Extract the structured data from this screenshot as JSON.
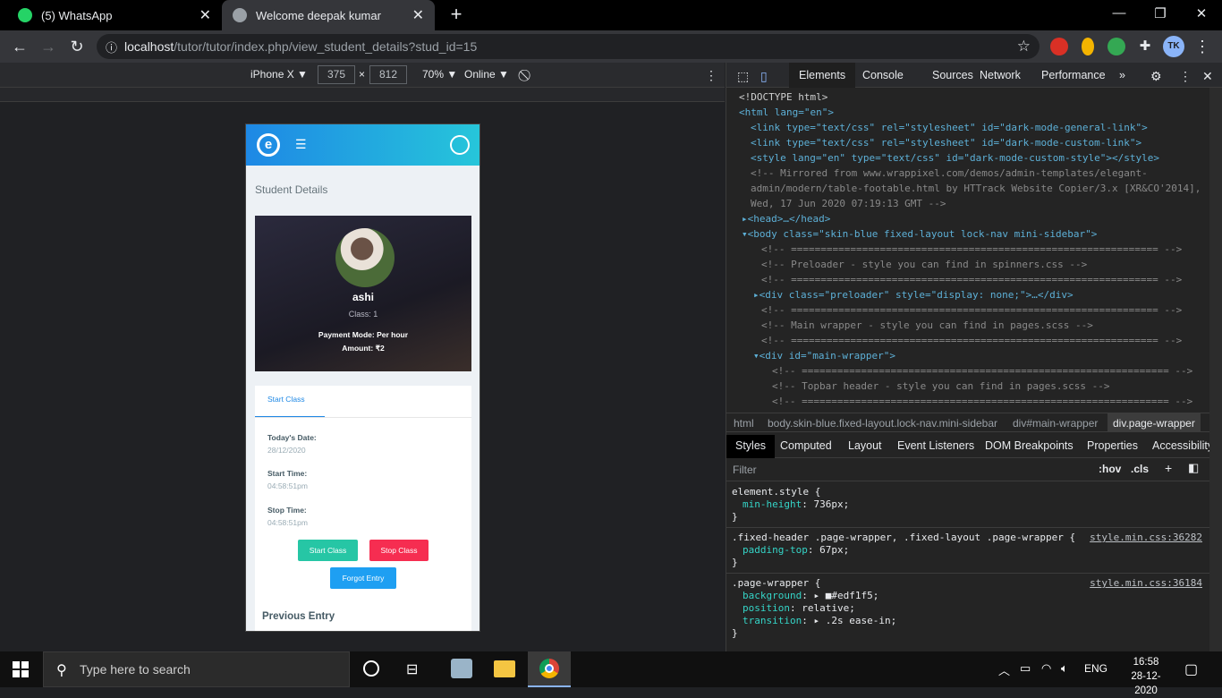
{
  "browser": {
    "tabs": [
      {
        "title": "(5) WhatsApp",
        "icon": "whatsapp-icon",
        "color": "#25d366"
      },
      {
        "title": "Welcome deepak kumar",
        "icon": "globe-icon",
        "color": "#9aa0a6"
      }
    ],
    "url_host": "localhost",
    "url_path": "/tutor/tutor/index.php/view_student_details?stud_id=15",
    "avatar_text": "TK"
  },
  "device_toolbar": {
    "device": "iPhone X ▼",
    "width": "375",
    "times": "×",
    "height": "812",
    "zoom": "70% ▼",
    "network": "Online ▼"
  },
  "app": {
    "logo_letter": "e",
    "page_title": "Student Details",
    "student": {
      "name": "ashi",
      "class": "Class: 1",
      "payment_mode": "Payment Mode: Per hour",
      "amount": "Amount: ₹2"
    },
    "tab_label": "Start Class",
    "fields": [
      {
        "label": "Today's Date:",
        "value": "28/12/2020"
      },
      {
        "label": "Start Time:",
        "value": "04:58:51pm"
      },
      {
        "label": "Stop Time:",
        "value": "04:58:51pm"
      }
    ],
    "buttons": {
      "start": "Start Class",
      "stop": "Stop Class",
      "forgot": "Forgot Entry"
    },
    "previous_heading": "Previous Entry",
    "colors": {
      "start": "#26c6a5",
      "stop": "#f62d51",
      "forgot": "#1e9ff2",
      "header_from": "#1e88e5",
      "header_to": "#26c6da"
    }
  },
  "devtools": {
    "tabs": [
      "Elements",
      "Console",
      "Sources",
      "Network",
      "Performance",
      "»"
    ],
    "code_lines": [
      "<!DOCTYPE html>",
      "<html lang=\"en\">",
      "<link type=\"text/css\" rel=\"stylesheet\" id=\"dark-mode-general-link\">",
      "<link type=\"text/css\" rel=\"stylesheet\" id=\"dark-mode-custom-link\">",
      "<style lang=\"en\" type=\"text/css\" id=\"dark-mode-custom-style\"></style>",
      "<!-- Mirrored from www.wrappixel.com/demos/admin-templates/elegant-",
      "admin/modern/table-footable.html by HTTrack Website Copier/3.x [XR&CO'2014],",
      "Wed, 17 Jun 2020 07:19:13 GMT -->",
      "▸<head>…</head>",
      "▾<body class=\"skin-blue fixed-layout lock-nav mini-sidebar\">",
      "<!-- ============================================================== -->",
      "<!-- Preloader - style you can find in spinners.css -->",
      "<!-- ============================================================== -->",
      "▸<div class=\"preloader\" style=\"display: none;\">…</div>",
      "<!-- ============================================================== -->",
      "<!-- Main wrapper - style you can find in pages.scss -->",
      "<!-- ============================================================== -->",
      "▾<div id=\"main-wrapper\">",
      "<!-- ============================================================== -->",
      "<!-- Topbar header - style you can find in pages.scss -->",
      "<!-- ============================================================== -->"
    ],
    "breadcrumbs": [
      "html",
      "body.skin-blue.fixed-layout.lock-nav.mini-sidebar",
      "div#main-wrapper",
      "div.page-wrapper"
    ],
    "style_tabs": [
      "Styles",
      "Computed",
      "Layout",
      "Event Listeners",
      "DOM Breakpoints",
      "Properties",
      "Accessibility"
    ],
    "filter_placeholder": "Filter",
    "filter_hov": ":hov",
    "filter_cls": ".cls",
    "rules": [
      {
        "selector": "element.style {",
        "props": [
          [
            "min-height",
            "736px;"
          ]
        ],
        "source": ""
      },
      {
        "selector": ".fixed-header .page-wrapper, .fixed-layout .page-wrapper {",
        "props": [
          [
            "padding-top",
            "67px;"
          ]
        ],
        "source": "style.min.css:36282"
      },
      {
        "selector": ".page-wrapper {",
        "props": [
          [
            "background",
            "▸ ■#edf1f5;"
          ],
          [
            "position",
            "relative;"
          ],
          [
            "transition",
            "▸ .2s ease-in;"
          ]
        ],
        "source": "style.min.css:36184"
      }
    ]
  },
  "taskbar": {
    "search_placeholder": "Type here to search",
    "lang": "ENG",
    "time": "16:58",
    "date": "28-12-2020"
  }
}
